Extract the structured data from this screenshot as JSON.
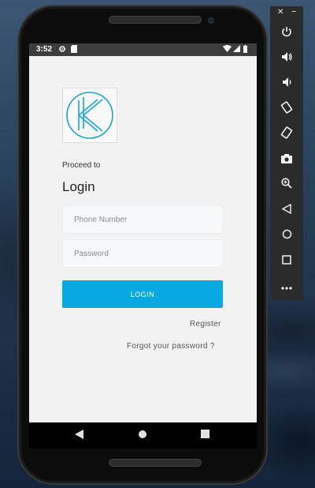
{
  "status_bar": {
    "time": "3:52",
    "icons": [
      "settings-icon",
      "sd-card-icon",
      "wifi-icon",
      "signal-icon",
      "battery-icon"
    ]
  },
  "app": {
    "logo": "kk-logo",
    "proceed_text": "Proceed to",
    "title": "Login",
    "phone_placeholder": "Phone Number",
    "password_placeholder": "Password",
    "login_button": "LOGIN",
    "register_link": "Register",
    "forgot_link": "Forgot your password ?",
    "accent_color": "#07a9e2"
  },
  "nav_bar": {
    "buttons": [
      "back-icon",
      "home-icon",
      "recents-icon"
    ]
  },
  "emulator_toolbar": {
    "window_buttons": [
      "close-icon",
      "minimize-icon"
    ],
    "buttons": [
      "power-icon",
      "volume-up-icon",
      "volume-down-icon",
      "rotate-left-icon",
      "rotate-right-icon",
      "camera-icon",
      "zoom-icon",
      "back-icon",
      "home-icon",
      "overview-icon",
      "more-icon"
    ]
  }
}
